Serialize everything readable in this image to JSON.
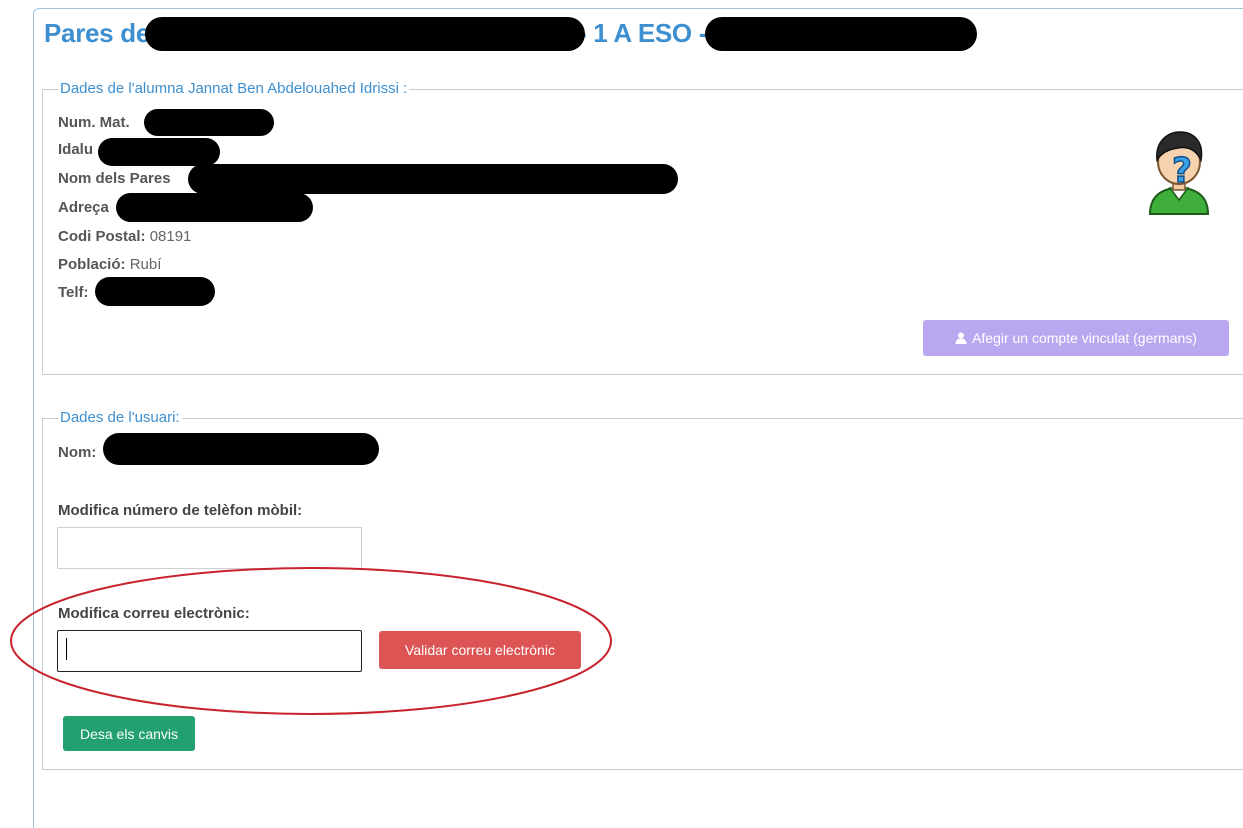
{
  "header": {
    "title_prefix": "Pares de",
    "title_middle": "- 1 A ESO -",
    "title_suffix": ")"
  },
  "student_section": {
    "legend": "Dades de l'alumna Jannat Ben Abdelouahed Idrissi :",
    "fields": {
      "num_mat_label": "Num. Mat.",
      "idalu_label": "Idalu",
      "parents_label": "Nom dels Pares",
      "address_label": "Adreça",
      "postal_label": "Codi Postal:",
      "postal_value": "08191",
      "town_label": "Població:",
      "town_value": "Rubí",
      "phone_label": "Telf:"
    },
    "avatar_icon": "user-unknown-icon",
    "link_button": {
      "icon": "user-icon",
      "label": "Afegir un compte vinculat (germans)"
    }
  },
  "user_section": {
    "legend": "Dades de l'usuari:",
    "name_label": "Nom:",
    "phone_label": "Modifica número de telèfon mòbil:",
    "phone_value": "",
    "email_label": "Modifica correu electrònic:",
    "email_value": "",
    "validate_button": "Validar correu electrònic",
    "save_button": "Desa els canvis"
  },
  "colors": {
    "accent": "#3d8fd0",
    "purple_button": "#b9a8f0",
    "red_button": "#dd5454",
    "green_button": "#22a06f",
    "annotation_ellipse": "#c8232c"
  }
}
